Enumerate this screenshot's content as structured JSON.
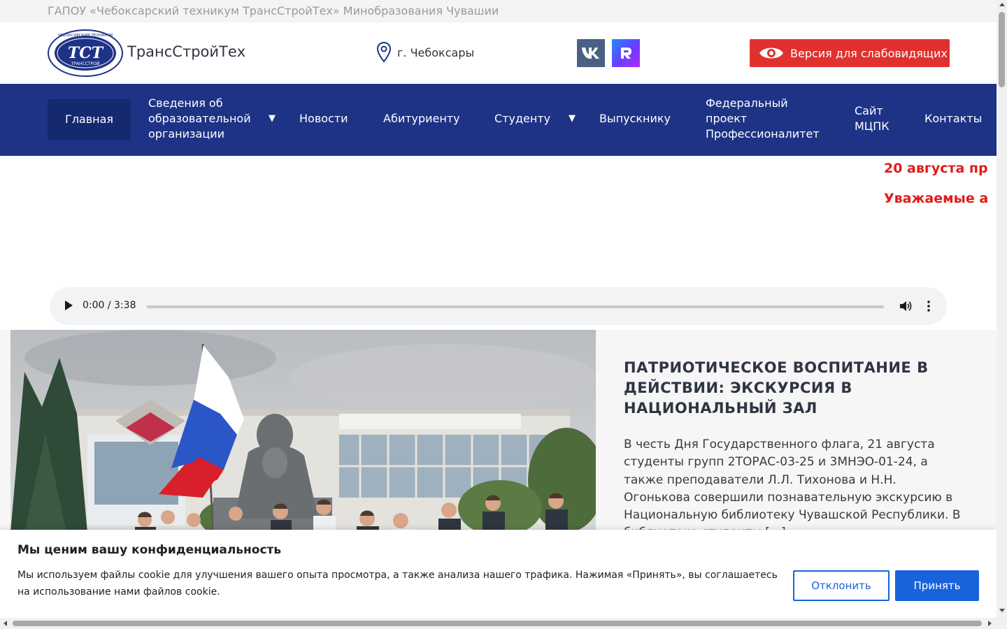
{
  "top_bar": {
    "org_name": "ГАПОУ «Чебоксарский техникум ТрансСтройТех» Минобразования Чувашии"
  },
  "header": {
    "brand": "ТрансСтройТех",
    "location": "г. Чебоксары",
    "social": [
      "vk-icon",
      "rutube-icon"
    ],
    "vision_button": "Версия для слабовидящих",
    "logo_text": [
      "ТСТ",
      "ТРАНССТРОЙ",
      "ЧЕБОКСАРСКИЙ ТЕХНИКУМ"
    ]
  },
  "nav": {
    "items": [
      {
        "label": "Главная",
        "active": true
      },
      {
        "label": "Сведения об образовательной организации",
        "dropdown": true
      },
      {
        "label": "Новости"
      },
      {
        "label": "Абитуриенту"
      },
      {
        "label": "Студенту",
        "dropdown": true
      },
      {
        "label": "Выпускнику"
      },
      {
        "label": "Федеральный проект Профессионалитет"
      },
      {
        "label": "Сайт МЦПК"
      },
      {
        "label": "Контакты"
      }
    ],
    "dropdown_caret": "▼"
  },
  "ticker": {
    "lines": [
      "20 августа пр",
      "Уважаемые а"
    ]
  },
  "audio_player": {
    "time": "0:00 / 3:38"
  },
  "featured_news": {
    "title": "ПАТРИОТИЧЕСКОЕ ВОСПИТАНИЕ В ДЕЙСТВИИ: ЭКСКУРСИЯ В НАЦИОНАЛЬНЫЙ ЗАЛ",
    "text": "В честь Дня Государственного флага, 21 августа студенты групп 2ТОРАС-03-25 и 3МНЭО-01-24, а также преподаватели Л.Л. Тихонова и Н.Н. Огонькова совершили познавательную экскурсию в Национальную библиотеку Чувашской Республики. В библиотеке студенты [...]"
  },
  "cookie_banner": {
    "title": "Мы ценим вашу конфиденциальность",
    "text": "Мы используем файлы cookie для улучшения вашего опыта просмотра,  а также анализа нашего трафика. Нажимая «Принять», вы соглашаетесь на использование нами файлов cookie.",
    "decline_label": "Отклонить",
    "accept_label": "Принять"
  },
  "colors": {
    "nav_bg": "#1e3386",
    "nav_active": "#15296f",
    "accent_red": "#e0312e",
    "ticker_red": "#e21a1a",
    "cookie_blue": "#1863dc"
  }
}
